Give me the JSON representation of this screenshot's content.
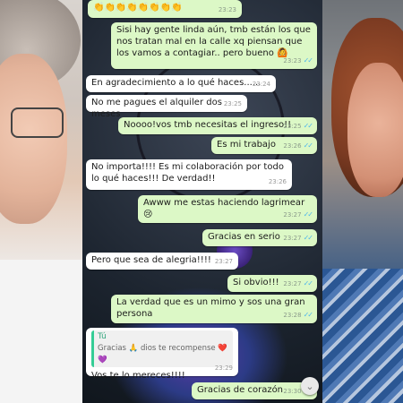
{
  "messages": [
    {
      "type": "out",
      "text": "👏👏👏👏👏👏👏👏",
      "time": "23:23",
      "ticks": ""
    },
    {
      "type": "out",
      "text": "Sisi hay gente linda aún, tmb están los que nos tratan mal en la calle xq piensan que los vamos a contagiar.. pero bueno 🙆",
      "time": "23:23",
      "ticks": "✓✓"
    },
    {
      "type": "in",
      "text": "En agradecimiento a lo qué haces......",
      "time": "23:24",
      "ticks": ""
    },
    {
      "type": "in",
      "text": "No me pagues el alquiler dos meses",
      "time": "23:25",
      "ticks": ""
    },
    {
      "type": "out",
      "text": "Noooo!vos tmb necesitas el ingreso!!",
      "time": "23:25",
      "ticks": "✓✓"
    },
    {
      "type": "out",
      "text": "Es mi trabajo",
      "time": "23:26",
      "ticks": "✓✓"
    },
    {
      "type": "in",
      "text": "No importa!!!! Es mi colaboración por todo lo qué haces!!! De verdad!!",
      "time": "23:26",
      "ticks": ""
    },
    {
      "type": "out",
      "text": "Awww me estas haciendo lagrimear 😢",
      "time": "23:27",
      "ticks": "✓✓"
    },
    {
      "type": "out",
      "text": "Gracias en serio",
      "time": "23:27",
      "ticks": "✓✓"
    },
    {
      "type": "in",
      "text": "Pero que sea de alegria!!!!",
      "time": "23:27",
      "ticks": ""
    },
    {
      "type": "out",
      "text": "Si obvio!!!",
      "time": "23:27",
      "ticks": "✓✓"
    },
    {
      "type": "out",
      "text": "La verdad que es un mimo y sos una gran persona",
      "time": "23:28",
      "ticks": "✓✓"
    },
    {
      "type": "in",
      "text": "Vos te lo mereces!!!!",
      "time": "23:29",
      "ticks": "",
      "quote": {
        "author": "Tú",
        "text": "Gracias 🙏 dios te recompense ❤️💜"
      }
    },
    {
      "type": "out",
      "text": "Gracias de corazón",
      "time": "23:30",
      "ticks": "✓✓"
    }
  ],
  "scroll_down_icon": "chevron-down-icon"
}
